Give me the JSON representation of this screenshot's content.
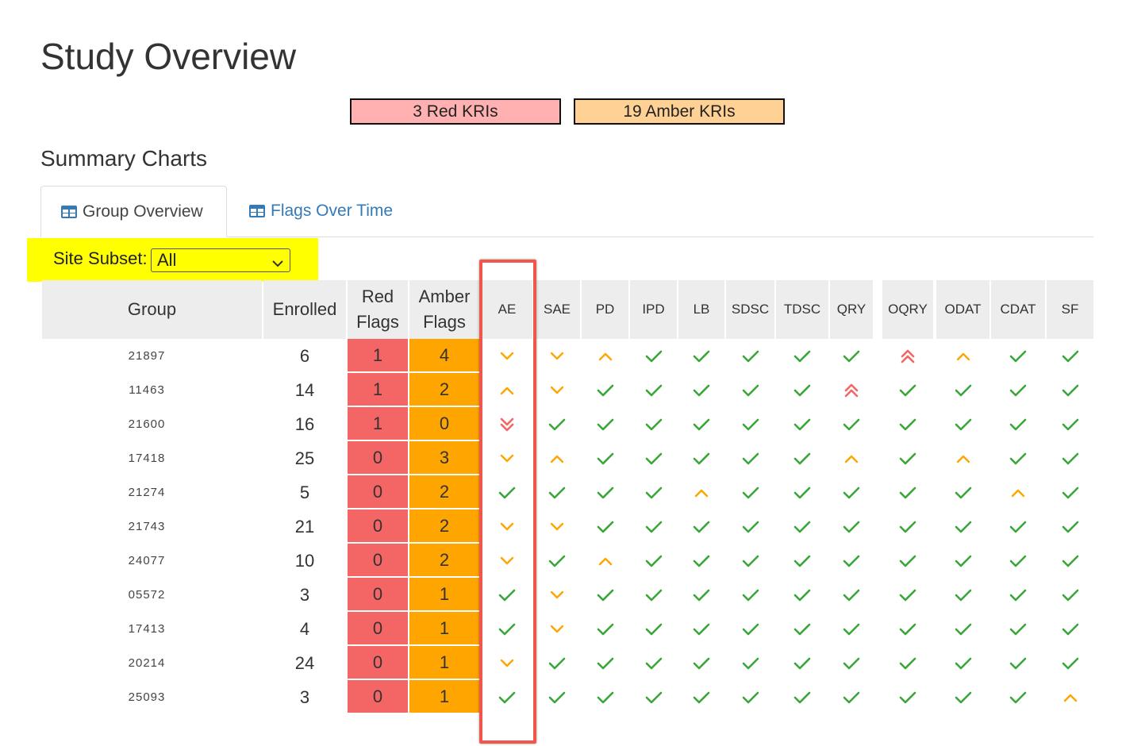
{
  "page": {
    "title": "Study Overview"
  },
  "kri": {
    "red_label": "3 Red KRIs",
    "amber_label": "19 Amber KRIs"
  },
  "summary": {
    "title": "Summary Charts"
  },
  "tabs": [
    {
      "label": "Group Overview",
      "icon": "table-icon",
      "active": true
    },
    {
      "label": "Flags Over Time",
      "icon": "table-icon",
      "active": false
    }
  ],
  "site_subset": {
    "label": "Site Subset:",
    "value": "All"
  },
  "colors": {
    "red": "#f46565",
    "amber": "#ffa500",
    "ok": "#3aa63a",
    "red_kri_bg": "#ffb0b0",
    "amber_kri_bg": "#ffd195",
    "highlight": "#ffff00"
  },
  "table": {
    "headers": {
      "group": "Group",
      "enrolled": "Enrolled",
      "red_l1": "Red",
      "red_l2": "Flags",
      "amber_l1": "Amber",
      "amber_l2": "Flags",
      "kris": [
        "AE",
        "SAE",
        "PD",
        "IPD",
        "LB",
        "SDSC",
        "TDSC",
        "QRY",
        "OQRY",
        "ODAT",
        "CDAT",
        "SF"
      ]
    },
    "rows": [
      {
        "group": "21897",
        "enrolled": "6",
        "red": "1",
        "amber": "4",
        "flags": [
          "down",
          "down",
          "up",
          "ok",
          "ok",
          "ok",
          "ok",
          "ok",
          "double-up",
          "up",
          "ok",
          "ok"
        ]
      },
      {
        "group": "11463",
        "enrolled": "14",
        "red": "1",
        "amber": "2",
        "flags": [
          "up",
          "down",
          "ok",
          "ok",
          "ok",
          "ok",
          "ok",
          "double-up",
          "ok",
          "ok",
          "ok",
          "ok"
        ]
      },
      {
        "group": "21600",
        "enrolled": "16",
        "red": "1",
        "amber": "0",
        "flags": [
          "double-down",
          "ok",
          "ok",
          "ok",
          "ok",
          "ok",
          "ok",
          "ok",
          "ok",
          "ok",
          "ok",
          "ok"
        ]
      },
      {
        "group": "17418",
        "enrolled": "25",
        "red": "0",
        "amber": "3",
        "flags": [
          "down",
          "up",
          "ok",
          "ok",
          "ok",
          "ok",
          "ok",
          "up",
          "ok",
          "up",
          "ok",
          "ok"
        ]
      },
      {
        "group": "21274",
        "enrolled": "5",
        "red": "0",
        "amber": "2",
        "flags": [
          "ok",
          "ok",
          "ok",
          "ok",
          "up",
          "ok",
          "ok",
          "ok",
          "ok",
          "ok",
          "up",
          "ok"
        ]
      },
      {
        "group": "21743",
        "enrolled": "21",
        "red": "0",
        "amber": "2",
        "flags": [
          "down",
          "down",
          "ok",
          "ok",
          "ok",
          "ok",
          "ok",
          "ok",
          "ok",
          "ok",
          "ok",
          "ok"
        ]
      },
      {
        "group": "24077",
        "enrolled": "10",
        "red": "0",
        "amber": "2",
        "flags": [
          "down",
          "ok",
          "up",
          "ok",
          "ok",
          "ok",
          "ok",
          "ok",
          "ok",
          "ok",
          "ok",
          "ok"
        ]
      },
      {
        "group": "05572",
        "enrolled": "3",
        "red": "0",
        "amber": "1",
        "flags": [
          "ok",
          "down",
          "ok",
          "ok",
          "ok",
          "ok",
          "ok",
          "ok",
          "ok",
          "ok",
          "ok",
          "ok"
        ]
      },
      {
        "group": "17413",
        "enrolled": "4",
        "red": "0",
        "amber": "1",
        "flags": [
          "ok",
          "down",
          "ok",
          "ok",
          "ok",
          "ok",
          "ok",
          "ok",
          "ok",
          "ok",
          "ok",
          "ok"
        ]
      },
      {
        "group": "20214",
        "enrolled": "24",
        "red": "0",
        "amber": "1",
        "flags": [
          "down",
          "ok",
          "ok",
          "ok",
          "ok",
          "ok",
          "ok",
          "ok",
          "ok",
          "ok",
          "ok",
          "ok"
        ]
      },
      {
        "group": "25093",
        "enrolled": "3",
        "red": "0",
        "amber": "1",
        "flags": [
          "ok",
          "ok",
          "ok",
          "ok",
          "ok",
          "ok",
          "ok",
          "ok",
          "ok",
          "ok",
          "ok",
          "up"
        ]
      }
    ]
  }
}
